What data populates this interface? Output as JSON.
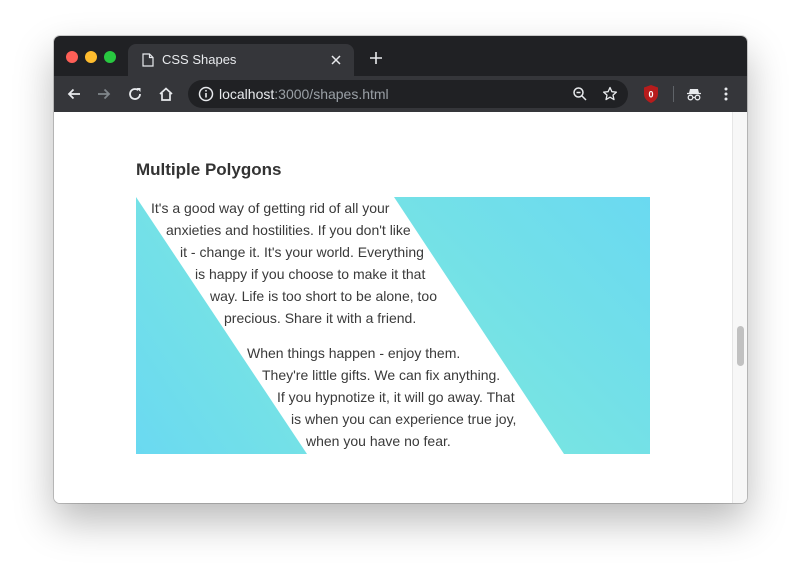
{
  "browser": {
    "tab": {
      "title": "CSS Shapes"
    },
    "address": {
      "host": "localhost",
      "path": ":3000/shapes.html"
    },
    "extension_badge": "0"
  },
  "page": {
    "heading": "Multiple Polygons",
    "paragraph1": [
      "It's a good way of getting rid of all your",
      "anxieties and hostilities. If you don't like",
      "it - change it. It's your world. Everything",
      "is happy if you choose to make it that",
      "way. Life is too short to be alone, too",
      "precious. Share it with a friend."
    ],
    "paragraph2": [
      "When things happen - enjoy them.",
      "They're little gifts. We can fix anything.",
      "If you hypnotize it, it will go away. That",
      "is when you can experience true joy,",
      "when you have no fear."
    ]
  },
  "colors": {
    "gradient_blue": "#6ad9f1",
    "gradient_teal": "#7ee9dc",
    "chrome_dark": "#202124",
    "chrome_toolbar": "#35363a",
    "extension_red": "#b71c1c"
  },
  "icons": {
    "tab": "page-icon",
    "back": "arrow-left-icon",
    "forward": "arrow-right-icon",
    "reload": "reload-icon",
    "home": "home-icon",
    "info": "info-icon",
    "zoom": "zoom-icon",
    "bookmark": "star-icon",
    "incognito": "incognito-icon",
    "menu": "kebab-menu-icon"
  }
}
